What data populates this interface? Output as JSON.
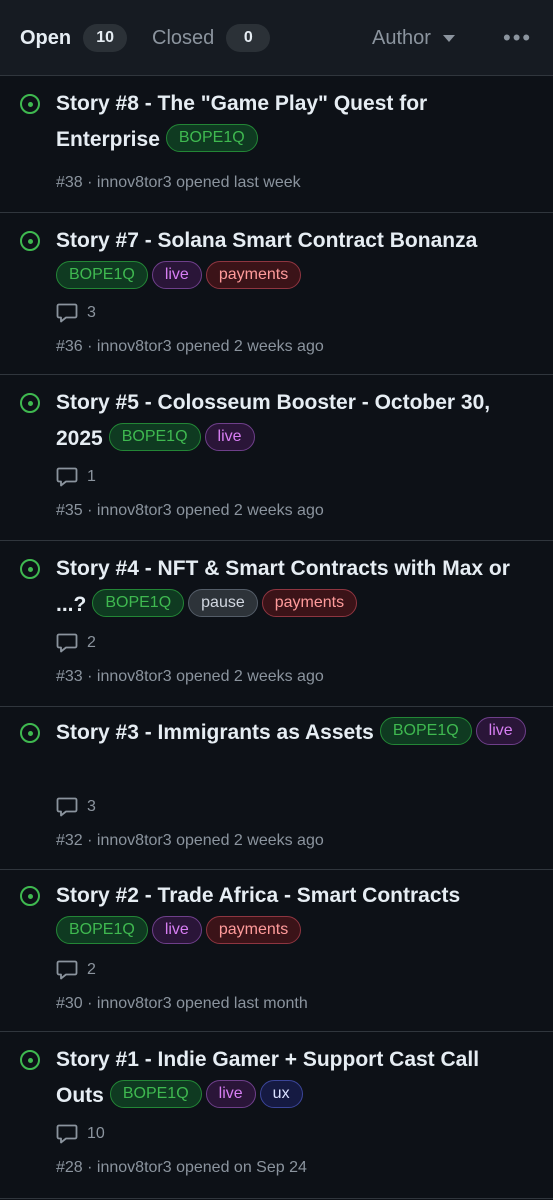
{
  "header": {
    "open_label": "Open",
    "open_count": "10",
    "closed_label": "Closed",
    "closed_count": "0",
    "author_label": "Author",
    "more_label": "•••"
  },
  "issues": [
    {
      "title": "Story #8 - The \"Game Play\" Quest for Enterprise",
      "labels": [
        "BOPE1Q"
      ],
      "comments": "",
      "meta": "#38 · innov8tor3 opened last week"
    },
    {
      "title": "Story #7 - Solana Smart Contract Bonanza",
      "labels": [
        "BOPE1Q",
        "live",
        "payments"
      ],
      "comments": "3",
      "meta": "#36 · innov8tor3 opened 2 weeks ago"
    },
    {
      "title": "Story #5 - Colosseum Booster - October 30, 2025",
      "labels": [
        "BOPE1Q",
        "live"
      ],
      "comments": "1",
      "meta": "#35 · innov8tor3 opened 2 weeks ago"
    },
    {
      "title": "Story #4 - NFT & Smart Contracts with Max or ...?",
      "labels": [
        "BOPE1Q",
        "pause",
        "payments"
      ],
      "comments": "2",
      "meta": "#33 · innov8tor3 opened 2 weeks ago"
    },
    {
      "title": "Story #3 - Immigrants as Assets",
      "labels": [
        "BOPE1Q",
        "live"
      ],
      "comments": "3",
      "meta": "#32 · innov8tor3 opened 2 weeks ago"
    },
    {
      "title": "Story #2 - Trade Africa - Smart Contracts",
      "labels": [
        "BOPE1Q",
        "live",
        "payments"
      ],
      "comments": "2",
      "meta": "#30 · innov8tor3 opened last month"
    },
    {
      "title": "Story #1 - Indie Gamer + Support Cast Call Outs",
      "labels": [
        "BOPE1Q",
        "live",
        "ux"
      ],
      "comments": "10",
      "meta": "#28 · innov8tor3 opened on Sep 24"
    }
  ],
  "label_colors": {
    "BOPE1Q": "#3fb950",
    "live": "#d77ef3",
    "payments": "#ff9b9b",
    "pause": "#d1d7e0",
    "ux": "#dbe2ff"
  },
  "colors": {
    "background": "#0d1117",
    "header": "#161b22",
    "open_icon": "#3fb950",
    "muted_text": "#8b949e"
  },
  "icons": {
    "status": "issue-opened-icon",
    "comments": "comment-icon",
    "author_dropdown": "chevron-down-icon",
    "more": "kebab-horizontal-icon"
  }
}
